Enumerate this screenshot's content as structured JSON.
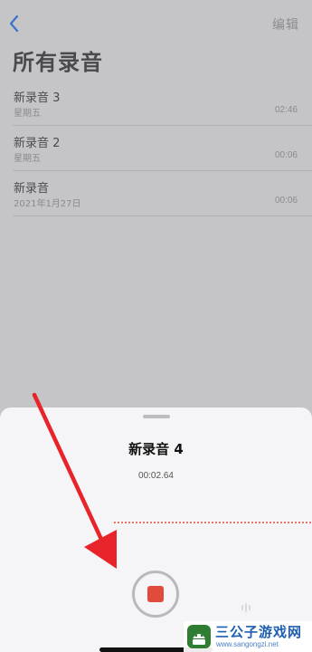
{
  "header": {
    "back_icon": "chevron-left-icon",
    "edit_label": "编辑",
    "title": "所有录音"
  },
  "recordings": [
    {
      "name": "新录音 3",
      "date": "星期五",
      "duration": "02:46"
    },
    {
      "name": "新录音 2",
      "date": "星期五",
      "duration": "00:06"
    },
    {
      "name": "新录音",
      "date": "2021年1月27日",
      "duration": "00:06"
    }
  ],
  "recorder": {
    "title": "新录音 4",
    "elapsed": "00:02.64",
    "stop_icon": "stop-icon",
    "side_icon": "waveform-icon"
  },
  "watermark": {
    "title": "三公子游戏网",
    "url": "www.sangongzi.net"
  },
  "colors": {
    "accent": "#3478f6",
    "record_red": "#e24a3b",
    "annotation_red": "#e8232a",
    "dim_background": "#c5c5c7",
    "sheet_background": "#f5f5f7"
  }
}
